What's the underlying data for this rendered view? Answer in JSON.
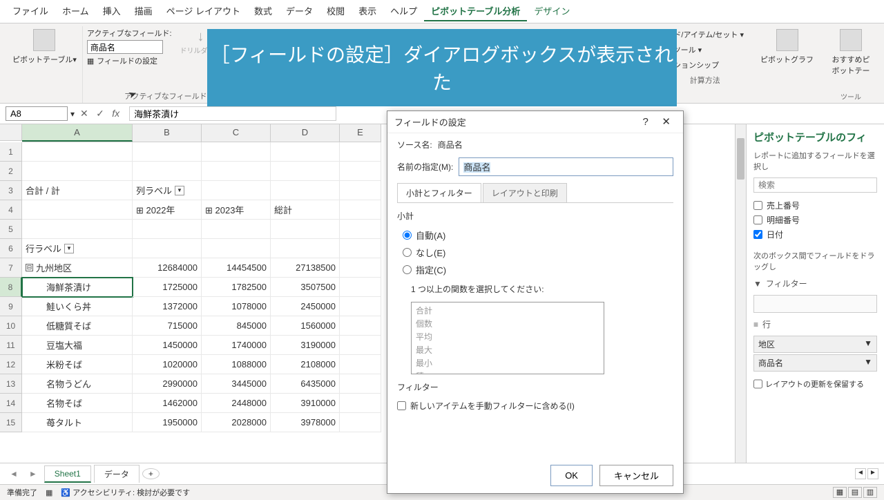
{
  "menu": {
    "items": [
      "ファイル",
      "ホーム",
      "挿入",
      "描画",
      "ページ レイアウト",
      "数式",
      "データ",
      "校閲",
      "表示",
      "ヘルプ",
      "ピボットテーブル分析",
      "デザイン"
    ],
    "active": "ピボットテーブル分析"
  },
  "ribbon": {
    "pivot_table": "ピボットテーブル▾",
    "active_field_label": "アクティブなフィールド:",
    "active_field_value": "商品名",
    "field_settings": "フィールドの設定",
    "drill_down": "ドリルダウン",
    "group_label": "アクティブなフィールド",
    "right": {
      "fields": "ルド/アイテム/セット ▾",
      "tools": "P ツール ▾",
      "relationship": "ーションシップ",
      "calc_method": "計算方法",
      "pivot_chart": "ピボットグラフ",
      "recommend": "おすすめピボットテー",
      "tools_label": "ツール"
    }
  },
  "banner": "［フィールドの設定］ダイアログボックスが表示された",
  "formula": {
    "namebox": "A8",
    "value": "海鮮茶漬け"
  },
  "columns": [
    "A",
    "B",
    "C",
    "D",
    "E"
  ],
  "col_widths": [
    "wA",
    "wB",
    "wC",
    "wD",
    "wE"
  ],
  "rows": [
    {
      "n": 1,
      "cells": [
        "",
        "",
        "",
        "",
        ""
      ]
    },
    {
      "n": 2,
      "cells": [
        "",
        "",
        "",
        "",
        ""
      ]
    },
    {
      "n": 3,
      "cells": [
        "合計 / 計",
        "列ラベル",
        "",
        "",
        ""
      ],
      "dd": [
        false,
        true,
        false,
        false,
        false
      ]
    },
    {
      "n": 4,
      "cells": [
        "",
        "⊞ 2022年",
        "⊞ 2023年",
        "総計",
        ""
      ]
    },
    {
      "n": 5,
      "cells": [
        "",
        "",
        "",
        "",
        ""
      ]
    },
    {
      "n": 6,
      "cells": [
        "行ラベル",
        "",
        "",
        "",
        ""
      ],
      "dd": [
        true,
        false,
        false,
        false,
        false
      ]
    },
    {
      "n": 7,
      "cells": [
        "九州地区",
        "12684000",
        "14454500",
        "27138500",
        ""
      ],
      "exp": "⊟",
      "num": [
        false,
        true,
        true,
        true,
        false
      ]
    },
    {
      "n": 8,
      "cells": [
        "海鮮茶漬け",
        "1725000",
        "1782500",
        "3507500",
        ""
      ],
      "indent": true,
      "sel": true,
      "num": [
        false,
        true,
        true,
        true,
        false
      ]
    },
    {
      "n": 9,
      "cells": [
        "鮭いくら丼",
        "1372000",
        "1078000",
        "2450000",
        ""
      ],
      "indent": true,
      "num": [
        false,
        true,
        true,
        true,
        false
      ]
    },
    {
      "n": 10,
      "cells": [
        "低糖質そば",
        "715000",
        "845000",
        "1560000",
        ""
      ],
      "indent": true,
      "num": [
        false,
        true,
        true,
        true,
        false
      ]
    },
    {
      "n": 11,
      "cells": [
        "豆塩大福",
        "1450000",
        "1740000",
        "3190000",
        ""
      ],
      "indent": true,
      "num": [
        false,
        true,
        true,
        true,
        false
      ]
    },
    {
      "n": 12,
      "cells": [
        "米粉そば",
        "1020000",
        "1088000",
        "2108000",
        ""
      ],
      "indent": true,
      "num": [
        false,
        true,
        true,
        true,
        false
      ]
    },
    {
      "n": 13,
      "cells": [
        "名物うどん",
        "2990000",
        "3445000",
        "6435000",
        ""
      ],
      "indent": true,
      "num": [
        false,
        true,
        true,
        true,
        false
      ]
    },
    {
      "n": 14,
      "cells": [
        "名物そば",
        "1462000",
        "2448000",
        "3910000",
        ""
      ],
      "indent": true,
      "num": [
        false,
        true,
        true,
        true,
        false
      ]
    },
    {
      "n": 15,
      "cells": [
        "苺タルト",
        "1950000",
        "2028000",
        "3978000",
        ""
      ],
      "indent": true,
      "num": [
        false,
        true,
        true,
        true,
        false
      ]
    }
  ],
  "dialog": {
    "title": "フィールドの設定",
    "source_label": "ソース名:",
    "source_value": "商品名",
    "name_label": "名前の指定(M):",
    "name_value": "商品名",
    "tab1": "小計とフィルター",
    "tab2": "レイアウトと印刷",
    "subtotal": "小計",
    "r_auto": "自動(A)",
    "r_none": "なし(E)",
    "r_spec": "指定(C)",
    "func_label": "1 つ以上の関数を選択してください:",
    "funcs": [
      "合計",
      "個数",
      "平均",
      "最大",
      "最小",
      "積"
    ],
    "filter_label": "フィルター",
    "chk_manual": "新しいアイテムを手動フィルターに含める(I)",
    "ok": "OK",
    "cancel": "キャンセル"
  },
  "field_pane": {
    "title": "ピボットテーブルのフィ",
    "sub": "レポートに追加するフィールドを選択し",
    "search": "検索",
    "fields": [
      {
        "label": "売上番号",
        "checked": false
      },
      {
        "label": "明細番号",
        "checked": false
      },
      {
        "label": "日付",
        "checked": true
      }
    ],
    "drag_label": "次のボックス間でフィールドをドラッグし",
    "filter": "フィルター",
    "rows_label": "行",
    "row_items": [
      "地区",
      "商品名"
    ],
    "defer": "レイアウトの更新を保留する"
  },
  "sheets": {
    "s1": "Sheet1",
    "s2": "データ"
  },
  "status": {
    "ready": "準備完了",
    "acc": "アクセシビリティ: 検討が必要です"
  }
}
